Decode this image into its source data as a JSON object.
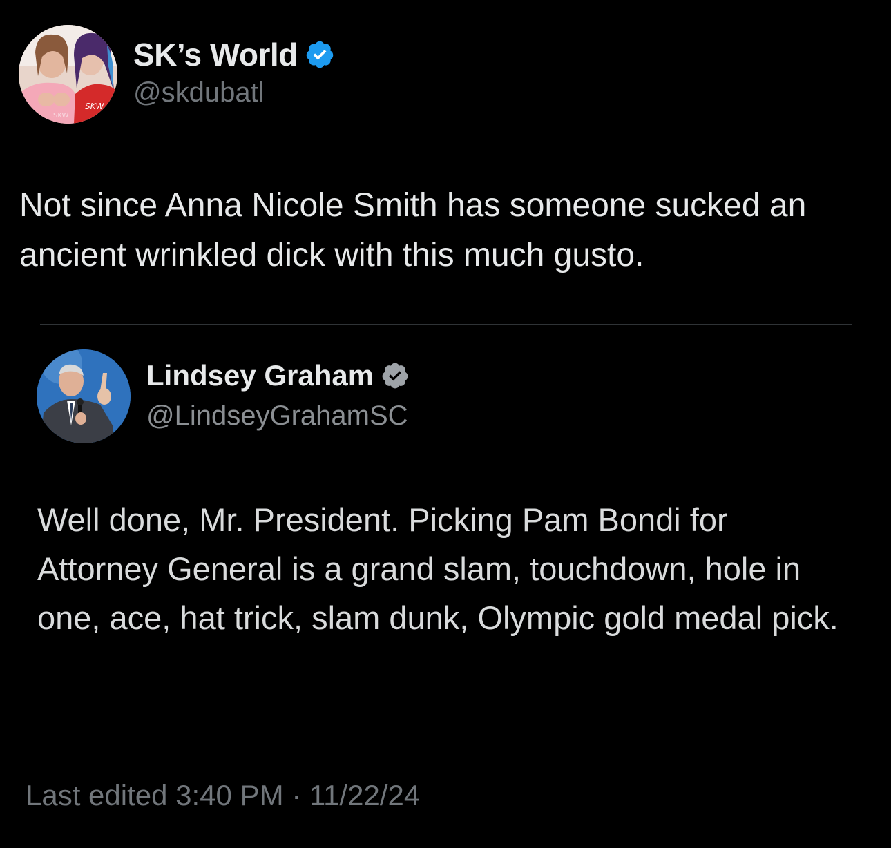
{
  "author": {
    "name": "SK’s World",
    "handle": "@skdubatl",
    "verified_color": "#1d9bf0",
    "avatar_text_left": "SKW",
    "avatar_text_right": "SKW"
  },
  "tweet": {
    "text": "Not since Anna Nicole Smith has someone sucked an ancient wrinkled dick with this much gusto."
  },
  "quoted": {
    "name": "Lindsey Graham",
    "handle": "@LindseyGrahamSC",
    "verified_color": "#9ea3a8",
    "text": "Well done, Mr. President. Picking Pam Bondi for Attorney General is a grand slam, touchdown, hole in one, ace, hat trick, slam dunk, Olympic gold medal pick."
  },
  "meta": {
    "edited": "Last edited 3:40 PM · 11/22/24"
  }
}
